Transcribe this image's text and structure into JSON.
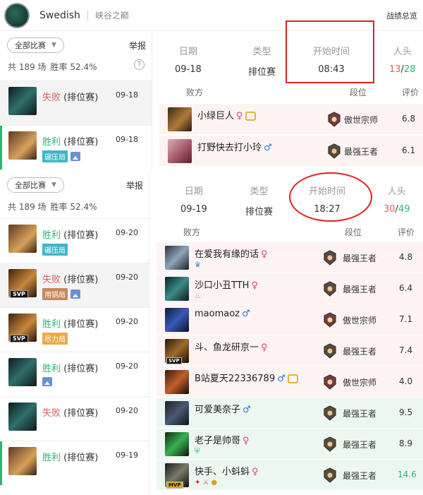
{
  "header": {
    "username": "Swedish",
    "server": "峡谷之巅",
    "overview_link": "战绩总览"
  },
  "panel1": {
    "filter_label": "全部比赛",
    "report_label": "举报",
    "stats_total": "共 189 场",
    "stats_winrate": "胜率 52.4%",
    "help": "?",
    "matches": [
      {
        "result": "失败",
        "result_type": "loss",
        "mode": "(排位赛)",
        "date": "09-18",
        "tags": []
      },
      {
        "result": "胜利",
        "result_type": "win",
        "mode": "(排位赛)",
        "date": "09-18",
        "tags": [
          "碾压局"
        ]
      }
    ],
    "info": {
      "date_label": "日期",
      "date_value": "09-18",
      "type_label": "类型",
      "type_value": "排位赛",
      "time_label": "开始时间",
      "time_value": "08:43",
      "kills_label": "人头",
      "kills_red": "13",
      "kills_sep": "/",
      "kills_green": "28"
    },
    "team_label": "败方",
    "rank_label": "段位",
    "rating_label": "评价",
    "players": [
      {
        "name": "小绿巨人",
        "gender": "♀",
        "gender_type": "f",
        "honor": true,
        "rank": "傲世宗师",
        "score": "6.8"
      },
      {
        "name": "打野快去打小玲",
        "gender": "♂",
        "gender_type": "m",
        "honor": false,
        "rank": "最强王者",
        "score": "6.1"
      }
    ]
  },
  "panel2": {
    "filter_label": "全部比赛",
    "report_label": "举报",
    "stats_total": "共 189 场",
    "stats_winrate": "胜率 52.4%",
    "help": "?",
    "matches": [
      {
        "result": "胜利",
        "result_type": "win",
        "mode": "(排位赛)",
        "date": "09-20",
        "tags": [
          "碾压局"
        ],
        "badge": ""
      },
      {
        "result": "失败",
        "result_type": "loss",
        "mode": "(排位赛)",
        "date": "09-20",
        "tags": [
          "用锅局"
        ],
        "badge": "SVP"
      },
      {
        "result": "胜利",
        "result_type": "win",
        "mode": "(排位赛)",
        "date": "09-20",
        "tags": [
          "尽力局"
        ],
        "badge": "SVP"
      },
      {
        "result": "胜利",
        "result_type": "win",
        "mode": "(排位赛)",
        "date": "09-20",
        "tags": [],
        "badge": ""
      },
      {
        "result": "失败",
        "result_type": "loss",
        "mode": "(排位赛)",
        "date": "09-20",
        "tags": [],
        "badge": ""
      },
      {
        "result": "胜利",
        "result_type": "win",
        "mode": "(排位赛)",
        "date": "09-19",
        "tags": [],
        "badge": ""
      }
    ],
    "info": {
      "date_label": "日期",
      "date_value": "09-19",
      "type_label": "类型",
      "type_value": "排位赛",
      "time_label": "开始时间",
      "time_value": "18:27",
      "kills_label": "人头",
      "kills_red": "30",
      "kills_sep": "/",
      "kills_green": "49"
    },
    "team_label": "败方",
    "rank_label": "段位",
    "rating_label": "评价",
    "players": [
      {
        "name": "在爱我有缘的话",
        "gender": "♀",
        "gender_type": "f",
        "honor": false,
        "rank": "最强王者",
        "score": "4.8",
        "badge": ""
      },
      {
        "name": "沙口小丑TTH",
        "gender": "♀",
        "gender_type": "f",
        "honor": false,
        "rank": "最强王者",
        "score": "6.4",
        "badge": ""
      },
      {
        "name": "maomaoz",
        "gender": "♂",
        "gender_type": "m",
        "honor": false,
        "rank": "傲世宗师",
        "score": "7.1",
        "badge": ""
      },
      {
        "name": "斗、鱼龙研京一",
        "gender": "♀",
        "gender_type": "f",
        "honor": false,
        "rank": "最强王者",
        "score": "7.4",
        "badge": "SVP"
      },
      {
        "name": "B站夏天22336789",
        "gender": "♂",
        "gender_type": "m",
        "honor": true,
        "rank": "傲世宗师",
        "score": "4.0",
        "badge": ""
      },
      {
        "name": "可爱美奈子",
        "gender": "♂",
        "gender_type": "m",
        "honor": false,
        "rank": "最强王者",
        "score": "9.5",
        "badge": ""
      },
      {
        "name": "老子是帅哥",
        "gender": "♀",
        "gender_type": "f",
        "honor": false,
        "rank": "最强王者",
        "score": "8.9",
        "badge": ""
      },
      {
        "name": "快手、小蚪蚪",
        "gender": "♀",
        "gender_type": "f",
        "honor": false,
        "rank": "最强王者",
        "score": "14.6",
        "badge": "MVP"
      }
    ]
  },
  "colors": {
    "win": "#2bb673",
    "loss": "#e25b5b",
    "annotation": "#e02020"
  }
}
